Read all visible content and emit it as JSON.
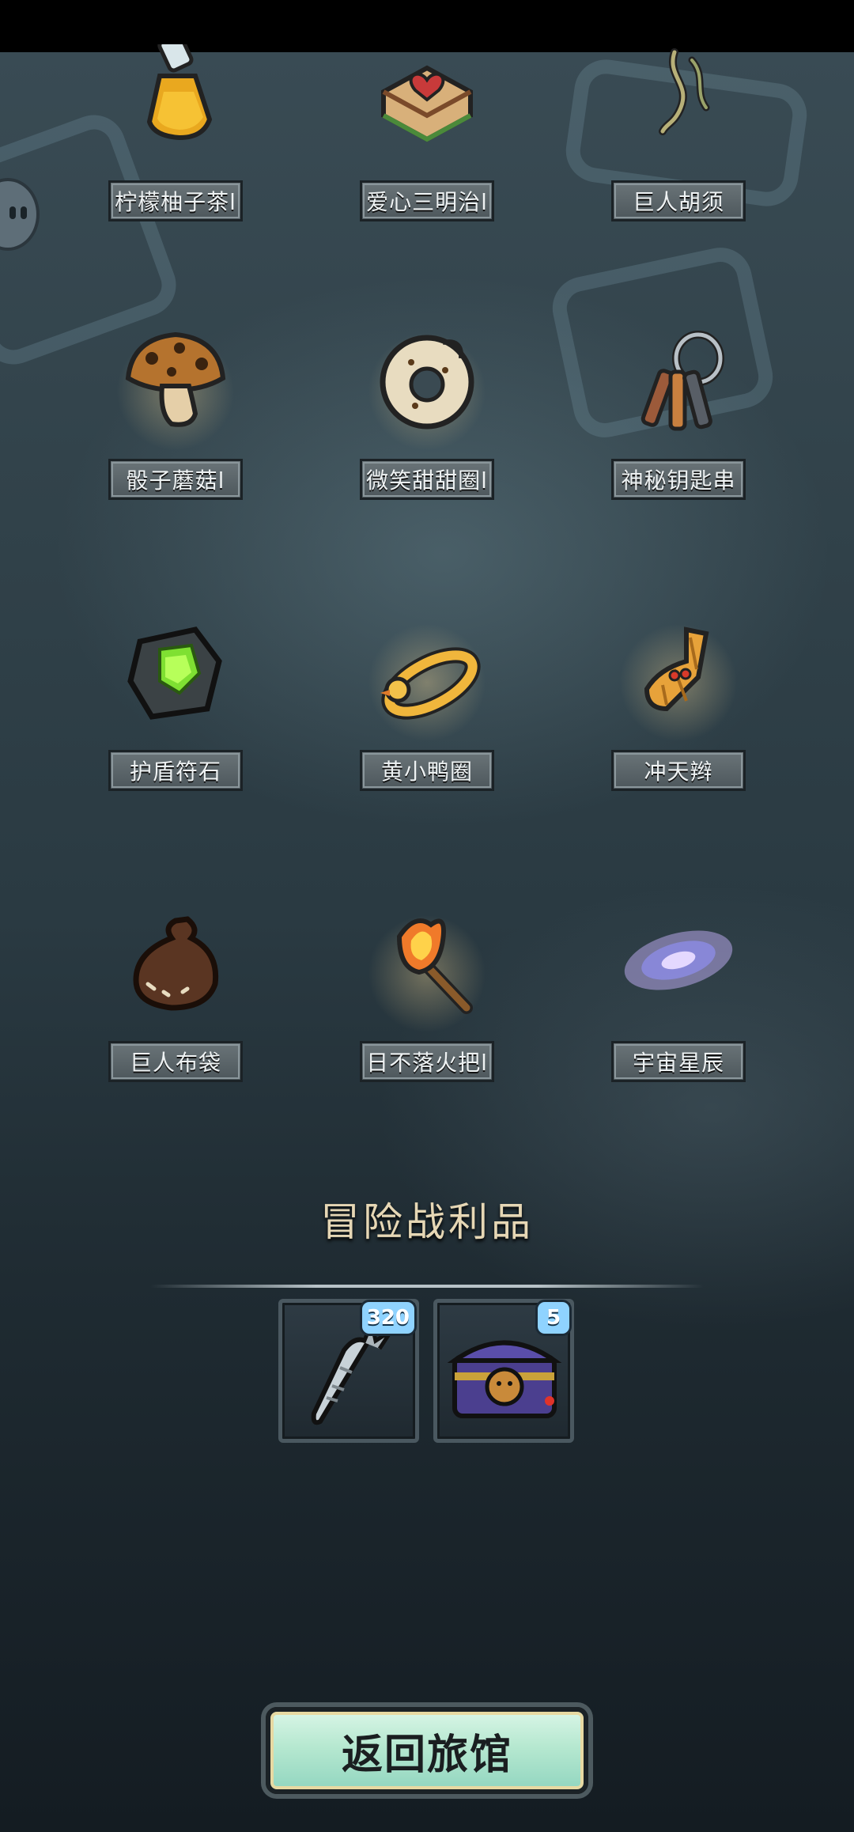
{
  "items": [
    {
      "label": "柠檬柚子茶l",
      "icon": "potion-bottle-icon"
    },
    {
      "label": "爱心三明治l",
      "icon": "heart-sandwich-icon"
    },
    {
      "label": "巨人胡须",
      "icon": "giant-beard-icon"
    },
    {
      "label": "骰子蘑菇l",
      "icon": "dice-mushroom-icon"
    },
    {
      "label": "微笑甜甜圈l",
      "icon": "smile-donut-icon"
    },
    {
      "label": "神秘钥匙串",
      "icon": "key-ring-icon"
    },
    {
      "label": "护盾符石",
      "icon": "shield-rune-stone-icon"
    },
    {
      "label": "黄小鸭圈",
      "icon": "duck-float-ring-icon"
    },
    {
      "label": "冲天辫",
      "icon": "pigtail-icon"
    },
    {
      "label": "巨人布袋",
      "icon": "giant-sack-icon"
    },
    {
      "label": "日不落火把l",
      "icon": "torch-icon"
    },
    {
      "label": "宇宙星辰",
      "icon": "galaxy-icon"
    }
  ],
  "loot": {
    "title": "冒险战利品",
    "rewards": [
      {
        "icon": "silver-carrot-icon",
        "count": "320"
      },
      {
        "icon": "monkey-treasure-chest-icon",
        "count": "5"
      }
    ]
  },
  "return_button": "返回旅馆",
  "colors": {
    "label_text": "#eef2f3",
    "loot_title": "#e6d7b5",
    "badge": "#8fd3ff",
    "button_fill": "#b6e8d0"
  }
}
